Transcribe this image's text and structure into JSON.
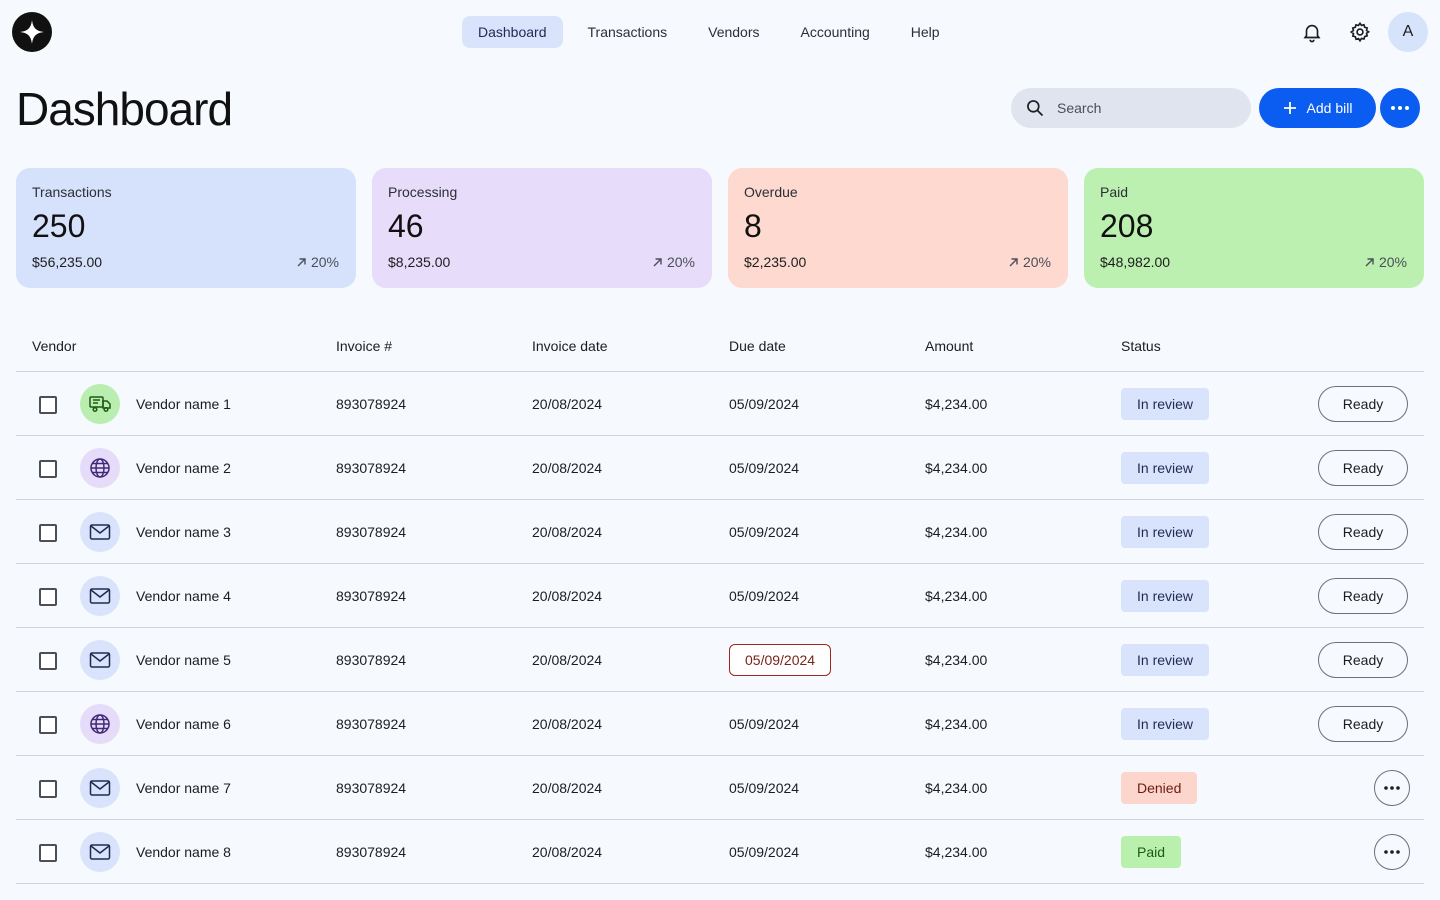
{
  "nav": {
    "logo_icon": "star-logo-icon",
    "items": [
      {
        "label": "Dashboard",
        "active": true
      },
      {
        "label": "Transactions",
        "active": false
      },
      {
        "label": "Vendors",
        "active": false
      },
      {
        "label": "Accounting",
        "active": false
      },
      {
        "label": "Help",
        "active": false
      }
    ],
    "avatar_initial": "A"
  },
  "header": {
    "title": "Dashboard",
    "search_placeholder": "Search",
    "add_bill_label": "Add bill"
  },
  "stats": [
    {
      "label": "Transactions",
      "count": "250",
      "amount": "$56,235.00",
      "trend": "20%",
      "color": "#d6e1fb"
    },
    {
      "label": "Processing",
      "count": "46",
      "amount": "$8,235.00",
      "trend": "20%",
      "color": "#e8dcfb"
    },
    {
      "label": "Overdue",
      "count": "8",
      "amount": "$2,235.00",
      "trend": "20%",
      "color": "#fdd9cf"
    },
    {
      "label": "Paid",
      "count": "208",
      "amount": "$48,982.00",
      "trend": "20%",
      "color": "#bcf0b0"
    }
  ],
  "table": {
    "headers": {
      "vendor": "Vendor",
      "invoice": "Invoice #",
      "invoice_date": "Invoice date",
      "due_date": "Due date",
      "amount": "Amount",
      "status": "Status"
    },
    "rows": [
      {
        "vendor": "Vendor name 1",
        "icon": "truck-icon",
        "icon_bg": "#b9eeb0",
        "invoice": "893078924",
        "invoice_date": "20/08/2024",
        "due_date": "05/09/2024",
        "overdue": false,
        "amount": "$4,234.00",
        "status": "In review",
        "status_type": "review",
        "action": "Ready"
      },
      {
        "vendor": "Vendor name 2",
        "icon": "globe-icon",
        "icon_bg": "#e6dcfa",
        "invoice": "893078924",
        "invoice_date": "20/08/2024",
        "due_date": "05/09/2024",
        "overdue": false,
        "amount": "$4,234.00",
        "status": "In review",
        "status_type": "review",
        "action": "Ready"
      },
      {
        "vendor": "Vendor name 3",
        "icon": "mail-icon",
        "icon_bg": "#d9e3fb",
        "invoice": "893078924",
        "invoice_date": "20/08/2024",
        "due_date": "05/09/2024",
        "overdue": false,
        "amount": "$4,234.00",
        "status": "In review",
        "status_type": "review",
        "action": "Ready"
      },
      {
        "vendor": "Vendor name 4",
        "icon": "mail-icon",
        "icon_bg": "#d9e3fb",
        "invoice": "893078924",
        "invoice_date": "20/08/2024",
        "due_date": "05/09/2024",
        "overdue": false,
        "amount": "$4,234.00",
        "status": "In review",
        "status_type": "review",
        "action": "Ready"
      },
      {
        "vendor": "Vendor name 5",
        "icon": "mail-icon",
        "icon_bg": "#d9e3fb",
        "invoice": "893078924",
        "invoice_date": "20/08/2024",
        "due_date": "05/09/2024",
        "overdue": true,
        "amount": "$4,234.00",
        "status": "In review",
        "status_type": "review",
        "action": "Ready"
      },
      {
        "vendor": "Vendor name 6",
        "icon": "globe-icon",
        "icon_bg": "#e6dcfa",
        "invoice": "893078924",
        "invoice_date": "20/08/2024",
        "due_date": "05/09/2024",
        "overdue": false,
        "amount": "$4,234.00",
        "status": "In review",
        "status_type": "review",
        "action": "Ready"
      },
      {
        "vendor": "Vendor name 7",
        "icon": "mail-icon",
        "icon_bg": "#d9e3fb",
        "invoice": "893078924",
        "invoice_date": "20/08/2024",
        "due_date": "05/09/2024",
        "overdue": false,
        "amount": "$4,234.00",
        "status": "Denied",
        "status_type": "denied",
        "action": ""
      },
      {
        "vendor": "Vendor name 8",
        "icon": "mail-icon",
        "icon_bg": "#d9e3fb",
        "invoice": "893078924",
        "invoice_date": "20/08/2024",
        "due_date": "05/09/2024",
        "overdue": false,
        "amount": "$4,234.00",
        "status": "Paid",
        "status_type": "paid",
        "action": ""
      }
    ]
  },
  "colors": {
    "primary": "#0b5cf0",
    "background": "#f6f9fe"
  }
}
